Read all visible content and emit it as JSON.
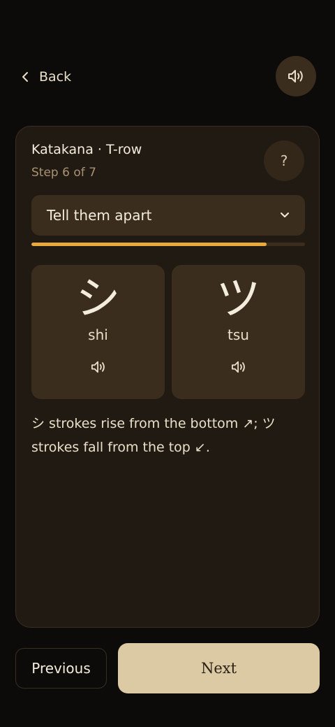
{
  "header": {
    "back_label": "Back",
    "back_icon": "chevron-left-icon",
    "sound_icon": "speaker-icon"
  },
  "card": {
    "title": "Katakana · T-row",
    "step": "Step 6 of 7",
    "help_label": "?",
    "mode": {
      "selected": "Tell them apart"
    },
    "progress": {
      "fraction": 0.86
    },
    "pair": [
      {
        "glyph": "シ",
        "romaji": "shi",
        "sound_icon": "speaker-icon"
      },
      {
        "glyph": "ツ",
        "romaji": "tsu",
        "sound_icon": "speaker-icon"
      }
    ],
    "tip": "シ strokes rise from the bottom ↗; ツ strokes fall from the top ↙."
  },
  "footer": {
    "previous_label": "Previous",
    "next_label": "Next"
  },
  "colors": {
    "background": "#0d0b09",
    "card": "#211a13",
    "surface": "#3a2d1d",
    "accent": "#e9aa3a",
    "next_button": "#dbcaa3"
  }
}
